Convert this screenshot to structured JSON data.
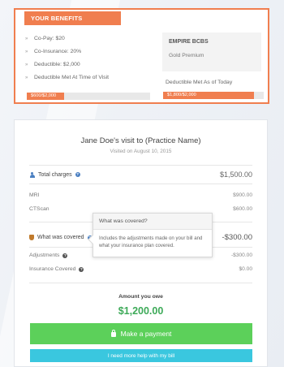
{
  "benefits": {
    "title": "YOUR BENEFITS",
    "items": [
      {
        "label": "Co-Pay: $20"
      },
      {
        "label": "Co-Insurance: 20%"
      },
      {
        "label": "Deductible: $2,000"
      },
      {
        "label": "Deductible Met At Time of Visit"
      }
    ],
    "plan": {
      "name": "EMPIRE BCBS",
      "tier": "Gold Premium"
    },
    "deductible_today_label": "Deductible Met As of Today",
    "bar_visit": {
      "text": "$600/$2,000",
      "fraction": 0.3
    },
    "bar_today": {
      "text": "$1,800/$2,000",
      "fraction": 0.9
    }
  },
  "visit": {
    "title": "Jane Doe's visit to (Practice Name)",
    "date": "Visited on August 10, 2015",
    "total_charges": {
      "label": "Total charges",
      "value": "$1,500.00"
    },
    "charges": [
      {
        "label": "MRI",
        "value": "$900.00"
      },
      {
        "label": "CTScan",
        "value": "$600.00"
      }
    ],
    "covered": {
      "label": "What was covered",
      "value": "-$300.00"
    },
    "adjustments": [
      {
        "label": "Adjustments",
        "value": "-$300.00"
      },
      {
        "label": "Insurance Covered",
        "value": "$0.00"
      }
    ],
    "tooltip": {
      "title": "What was covered?",
      "body": "Includes the adjustments made on your bill and what your insurance plan covered."
    },
    "owe_label": "Amount you owe",
    "owe_amount": "$1,200.00",
    "pay_button": "Make a payment",
    "help_button": "I need more help with my bill"
  },
  "colors": {
    "accent": "#f07e4f",
    "pay": "#5cd05a",
    "help": "#3ac7df",
    "owe": "#3daa58"
  }
}
